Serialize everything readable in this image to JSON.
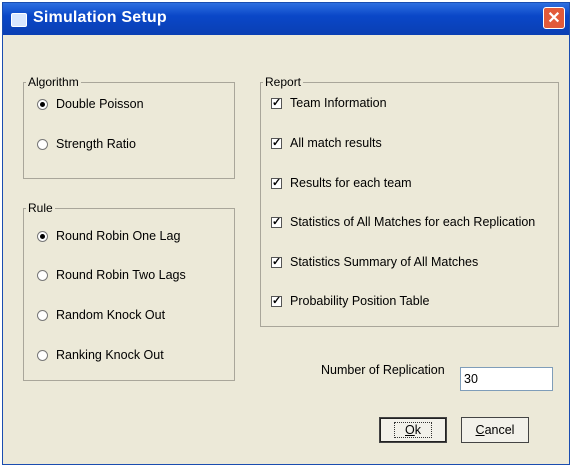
{
  "window": {
    "title": "Simulation Setup",
    "close_label": "✕"
  },
  "algorithm": {
    "legend": "Algorithm",
    "options": [
      {
        "label": "Double Poisson",
        "selected": true
      },
      {
        "label": "Strength Ratio",
        "selected": false
      }
    ]
  },
  "rule": {
    "legend": "Rule",
    "options": [
      {
        "label": "Round Robin One Lag",
        "selected": true
      },
      {
        "label": "Round Robin Two Lags",
        "selected": false
      },
      {
        "label": "Random  Knock Out",
        "selected": false
      },
      {
        "label": "Ranking  Knock Out",
        "selected": false
      }
    ]
  },
  "report": {
    "legend": "Report",
    "options": [
      {
        "label": "Team Information",
        "checked": true
      },
      {
        "label": "All match results",
        "checked": true
      },
      {
        "label": "Results for each team",
        "checked": true
      },
      {
        "label": "Statistics of All Matches for each Replication",
        "checked": true
      },
      {
        "label": "Statistics Summary of All Matches",
        "checked": true
      },
      {
        "label": "Probability Position Table",
        "checked": true
      }
    ]
  },
  "replication": {
    "label": "Number of Replication",
    "value": "30"
  },
  "buttons": {
    "ok_mnemonic": "O",
    "ok_rest": "k",
    "cancel_mnemonic": "C",
    "cancel_rest": "ancel"
  }
}
